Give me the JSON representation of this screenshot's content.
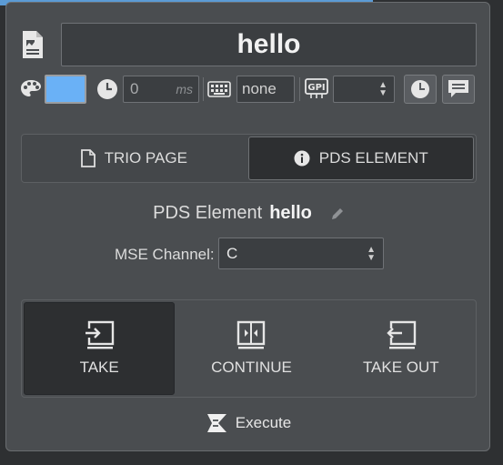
{
  "title": "hello",
  "toolbar": {
    "color_value": "#6ab1f6",
    "delay_value": "0",
    "delay_unit": "ms",
    "keyboard_value": "none",
    "gpi_value": ""
  },
  "tabs": [
    {
      "label": "TRIO PAGE",
      "icon": "document-icon",
      "active": false
    },
    {
      "label": "PDS ELEMENT",
      "icon": "info-icon",
      "active": true
    }
  ],
  "element": {
    "prefix": "PDS Element",
    "name": "hello"
  },
  "channel": {
    "label": "MSE Channel:",
    "value": "C"
  },
  "actions": [
    {
      "label": "TAKE",
      "icon": "take-icon",
      "active": true
    },
    {
      "label": "CONTINUE",
      "icon": "continue-icon",
      "active": false
    },
    {
      "label": "TAKE OUT",
      "icon": "take-out-icon",
      "active": false
    }
  ],
  "execute_label": "Execute",
  "colors": {
    "accent": "#6ab1f6",
    "panel": "#4a4d50",
    "active": "#2d2f31"
  }
}
